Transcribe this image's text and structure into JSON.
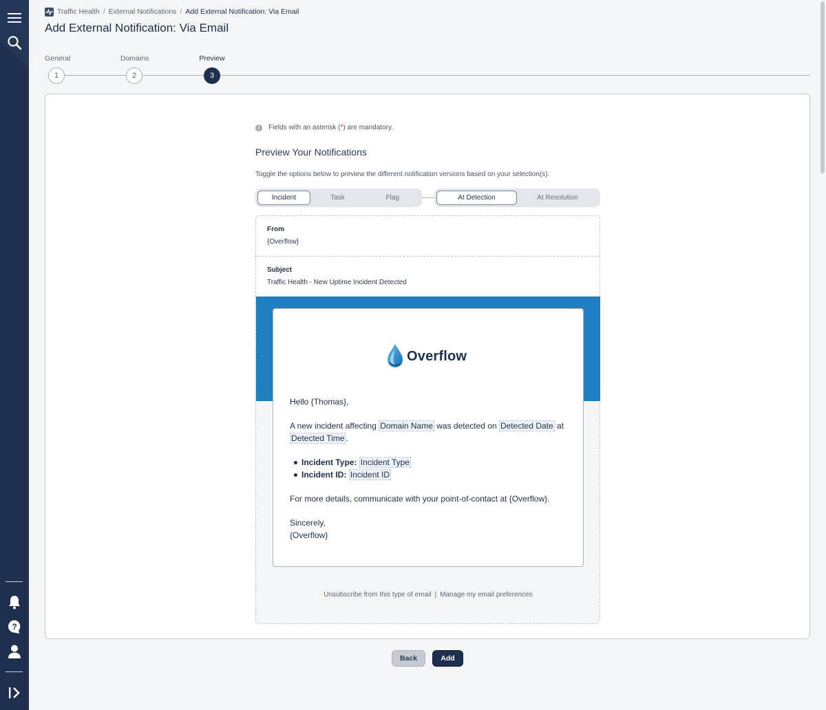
{
  "sidebar": {
    "top_icons": [
      "menu-icon",
      "search-icon"
    ],
    "bottom_icons": [
      "bell-icon",
      "help-icon",
      "user-icon",
      "expand-sidebar-icon"
    ]
  },
  "breadcrumb": {
    "items": [
      "Traffic Health",
      "External Notifications",
      "Add External Notification: Via Email"
    ]
  },
  "page_title": "Add External Notification: Via Email",
  "stepper": {
    "steps": [
      {
        "label": "General",
        "number": "1"
      },
      {
        "label": "Domains",
        "number": "2"
      },
      {
        "label": "Preview",
        "number": "3"
      }
    ],
    "active_step": 3
  },
  "form": {
    "mandatory_prefix": "Fields with an asterisk (",
    "mandatory_asterisk": "*",
    "mandatory_suffix": ") are mandatory.",
    "preview_title": "Preview Your Notifications",
    "preview_description": "Toggle the options below to preview the different notification versions based on your selection(s).",
    "type_toggle": [
      "Incident",
      "Task",
      "Flag"
    ],
    "type_selected": "Incident",
    "stage_toggle": [
      "At Detection",
      "At Resolution"
    ],
    "stage_selected": "At Detection",
    "from_label": "From",
    "from_value": "{Overflow}",
    "subject_label": "Subject",
    "subject_value": "Traffic Health - New Uptime Incident Detected"
  },
  "email": {
    "brand_name": "Overflow",
    "greeting": "Hello {Thomas},",
    "line1_a": "A new incident affecting ",
    "ph_domain": "Domain Name",
    "line1_b": " was detected on ",
    "ph_date": "Detected Date",
    "line1_c": " at ",
    "ph_time": "Detected Time",
    "line1_d": ".",
    "bullet1_label": "Incident Type:",
    "ph_type": "Incident Type",
    "bullet2_label": "Incident ID:",
    "ph_id": "Incident ID",
    "details": "For more details, communicate with your point-of-contact at {Overflow}.",
    "closing": "Sincerely,",
    "signature": "{Overflow}",
    "unsubscribe": "Unsubscribe from this type of email",
    "footer_sep": "|",
    "preferences": "Manage my email preferences"
  },
  "colors": {
    "sidebar": "#1e2f4f",
    "banner": "#1f7fc1",
    "primary_button": "#1e2f4f"
  },
  "actions": {
    "back": "Back",
    "add": "Add"
  }
}
